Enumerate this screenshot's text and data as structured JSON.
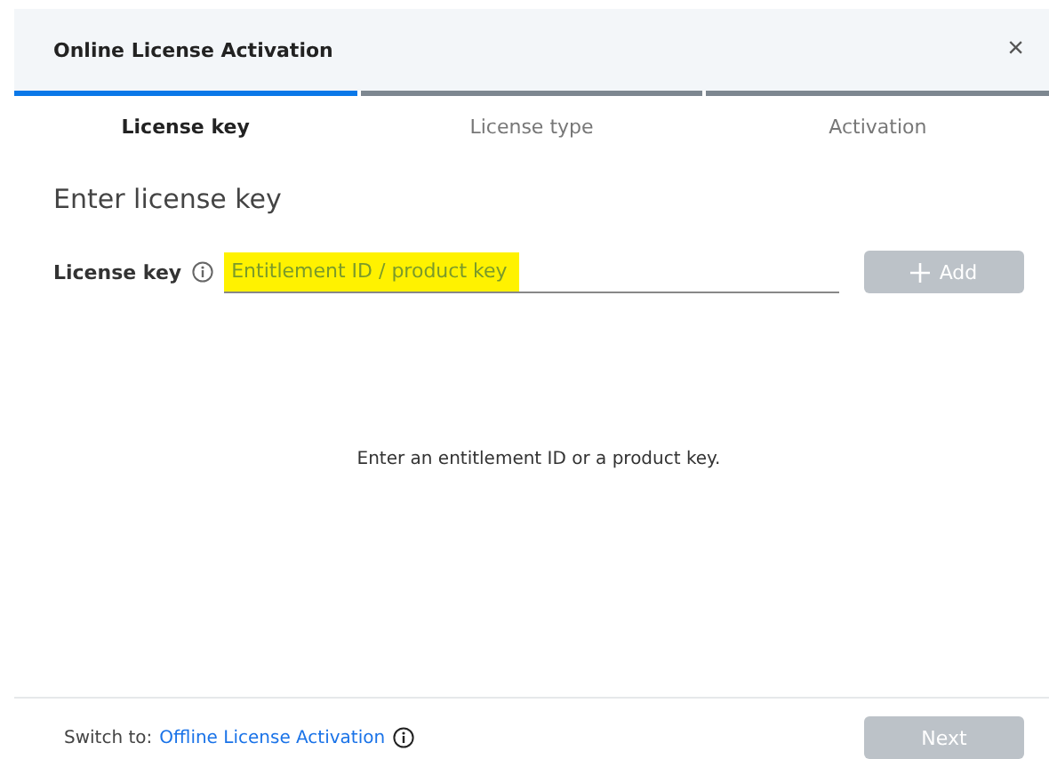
{
  "window": {
    "title": "Online License Activation",
    "close": "×"
  },
  "tabs": [
    {
      "label": "License key",
      "selected": true
    },
    {
      "label": "License type",
      "selected": false
    },
    {
      "label": "Activation",
      "selected": false
    }
  ],
  "heading": "Enter license key",
  "field": {
    "label": "License key",
    "placeholder": "Entitlement ID / product key",
    "highlighted": true
  },
  "add_button": {
    "label": "Add",
    "disabled": true
  },
  "message": "Enter an entitlement ID or a product key.",
  "footer": {
    "prefix": "Switch to:",
    "link": "Offline License Activation"
  },
  "next_button": {
    "label": "Next",
    "disabled": true
  }
}
